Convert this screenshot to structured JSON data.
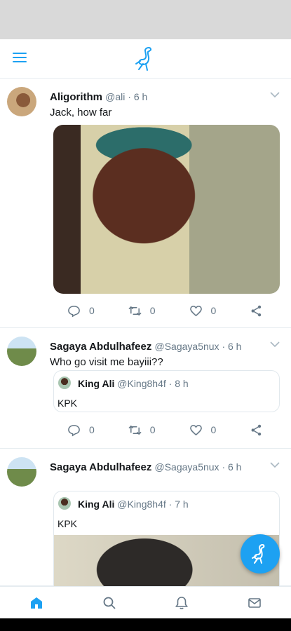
{
  "app": {
    "name": "Twitter Lite",
    "accent": "#1da1f2"
  },
  "tweets": [
    {
      "name": "Aligorithm",
      "handle": "@ali · 6 h",
      "text": "Jack, how far",
      "counts": {
        "reply": "0",
        "retweet": "0",
        "like": "0"
      }
    },
    {
      "name": "Sagaya Abdulhafeez",
      "handle": "@Sagaya5nux · 6 h",
      "text": "Who go visit me bayiii??",
      "quote": {
        "name": "King Ali",
        "handle": "@King8h4f · 8 h",
        "text": "KPK"
      },
      "counts": {
        "reply": "0",
        "retweet": "0",
        "like": "0"
      }
    },
    {
      "name": "Sagaya Abdulhafeez",
      "handle": "@Sagaya5nux · 6 h",
      "quote": {
        "name": "King Ali",
        "handle": "@King8h4f · 7 h",
        "text": "KPK"
      }
    }
  ],
  "icons": {
    "menu": "hamburger-icon",
    "logo": "ostrich-logo",
    "home": "home-icon",
    "search": "search-icon",
    "notifications": "bell-icon",
    "messages": "mail-icon",
    "compose": "compose-icon"
  }
}
